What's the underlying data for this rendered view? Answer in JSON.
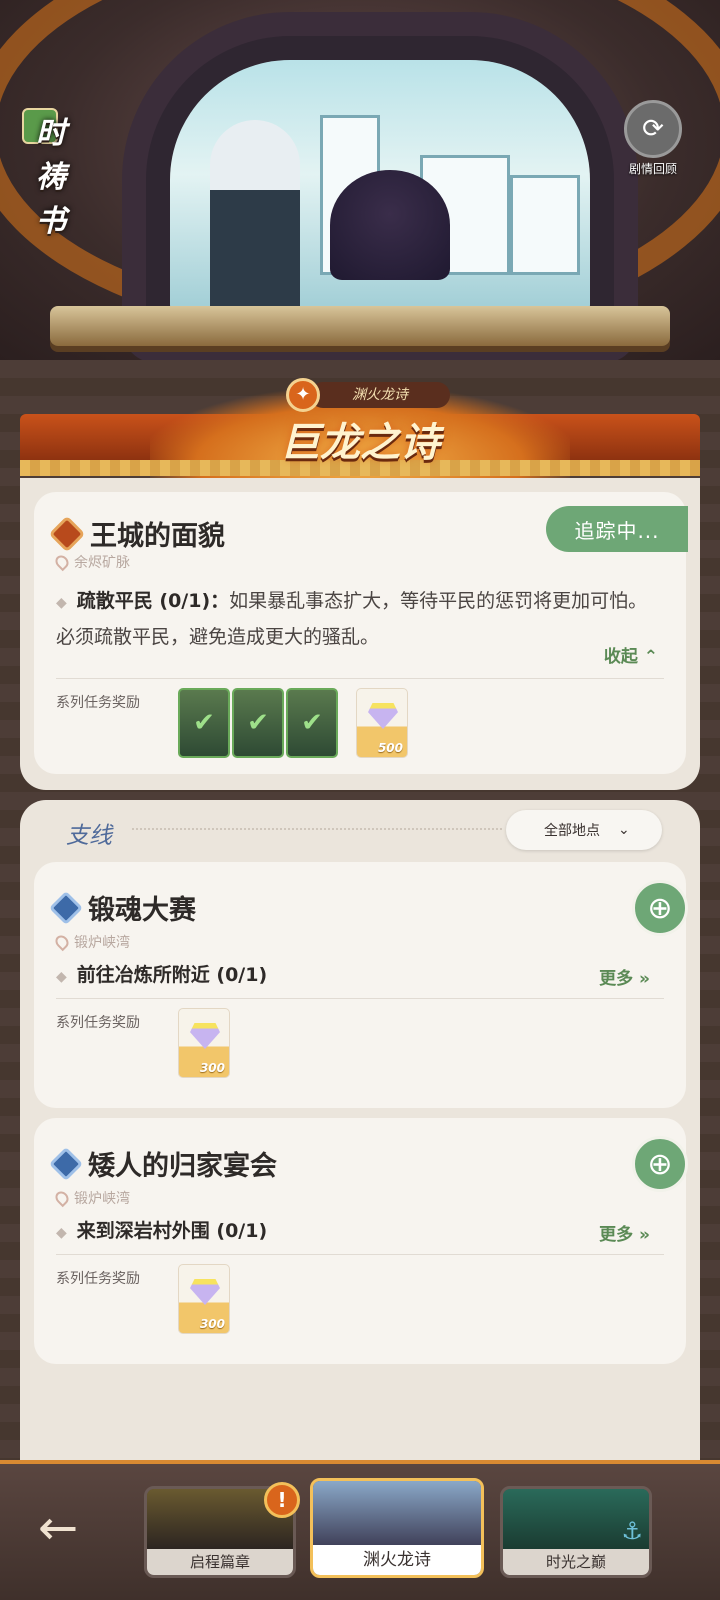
{
  "header": {
    "logo": "时祷书",
    "replay_label": "剧情回顾"
  },
  "banner": {
    "subtitle": "渊火龙诗",
    "title": "巨龙之诗"
  },
  "main_quest": {
    "title": "王城的面貌",
    "location": "余烬矿脉",
    "tracking_label": "追踪中...",
    "objective_name": "疏散平民 (0/1)：",
    "objective_text": "如果暴乱事态扩大，等待平民的惩罚将更加可怕。必须疏散平民，避免造成更大的骚乱。",
    "collapse_label": "收起",
    "reward_label": "系列任务奖励",
    "gem_count": "500"
  },
  "side": {
    "header": "支线",
    "filter_label": "全部地点",
    "quests": [
      {
        "title": "锻魂大赛",
        "location": "锻炉峡湾",
        "step": "前往冶炼所附近 (0/1)",
        "more_label": "更多",
        "reward_label": "系列任务奖励",
        "gem_count": "300"
      },
      {
        "title": "矮人的归家宴会",
        "location": "锻炉峡湾",
        "step": "来到深岩村外围 (0/1)",
        "more_label": "更多",
        "reward_label": "系列任务奖励",
        "gem_count": "300"
      }
    ]
  },
  "chapters": [
    {
      "label": "启程篇章"
    },
    {
      "label": "渊火龙诗"
    },
    {
      "label": "时光之巅"
    }
  ],
  "colors": {
    "accent_green": "#6ea776",
    "accent_orange": "#d9651c",
    "side_blue": "#4f6a9a"
  }
}
